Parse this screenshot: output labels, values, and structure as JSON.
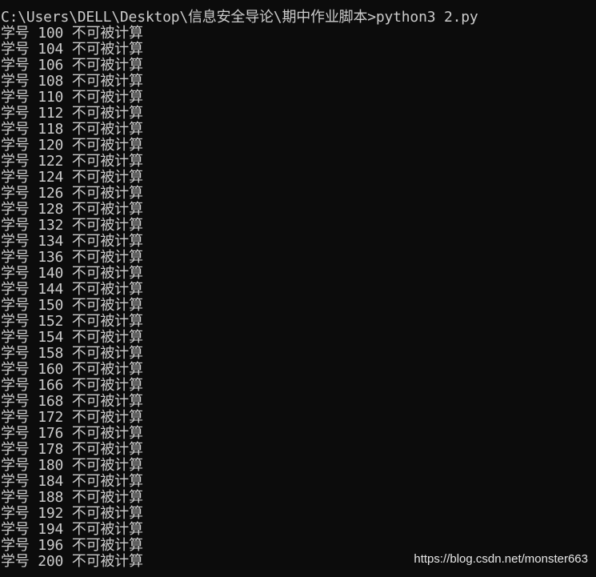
{
  "terminal": {
    "prompt_line": "C:\\Users\\DELL\\Desktop\\信息安全导论\\期中作业脚本>python3 2.py",
    "output_lines": [
      "学号 100 不可被计算",
      "学号 104 不可被计算",
      "学号 106 不可被计算",
      "学号 108 不可被计算",
      "学号 110 不可被计算",
      "学号 112 不可被计算",
      "学号 118 不可被计算",
      "学号 120 不可被计算",
      "学号 122 不可被计算",
      "学号 124 不可被计算",
      "学号 126 不可被计算",
      "学号 128 不可被计算",
      "学号 132 不可被计算",
      "学号 134 不可被计算",
      "学号 136 不可被计算",
      "学号 140 不可被计算",
      "学号 144 不可被计算",
      "学号 150 不可被计算",
      "学号 152 不可被计算",
      "学号 154 不可被计算",
      "学号 158 不可被计算",
      "学号 160 不可被计算",
      "学号 166 不可被计算",
      "学号 168 不可被计算",
      "学号 172 不可被计算",
      "学号 176 不可被计算",
      "学号 178 不可被计算",
      "学号 180 不可被计算",
      "学号 184 不可被计算",
      "学号 188 不可被计算",
      "学号 192 不可被计算",
      "学号 194 不可被计算",
      "学号 196 不可被计算",
      "学号 200 不可被计算"
    ]
  },
  "watermark": "https://blog.csdn.net/monster663",
  "colors": {
    "background": "#0c0c0c",
    "text": "#cccccc"
  }
}
